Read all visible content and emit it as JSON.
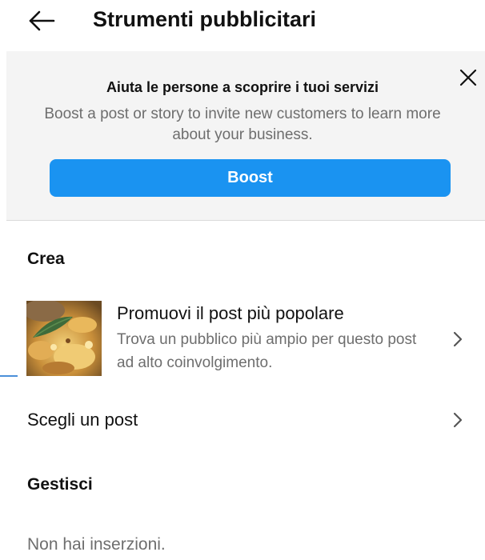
{
  "header": {
    "title": "Strumenti pubblicitari",
    "back_icon": "arrow-left-icon"
  },
  "promo": {
    "title": "Aiuta le persone a scoprire i tuoi servizi",
    "description": "Boost a post or story to invite new customers to learn more about your business.",
    "button_label": "Boost",
    "button_color": "#1a93f1",
    "close_icon": "close-icon"
  },
  "create": {
    "section_label": "Crea",
    "promote_popular": {
      "title": "Promuovi il post più popolare",
      "subtitle": "Trova un pubblico più ampio per questo post ad alto coinvolgimento."
    },
    "choose_post": {
      "label": "Scegli un post"
    }
  },
  "manage": {
    "section_label": "Gestisci",
    "empty_text": "Non hai inserzioni."
  }
}
